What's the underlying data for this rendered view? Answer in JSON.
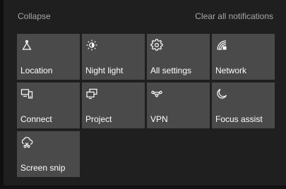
{
  "header": {
    "collapse_label": "Collapse",
    "clear_label": "Clear all notifications"
  },
  "tiles": [
    {
      "label": "Location",
      "icon": "location-icon"
    },
    {
      "label": "Night light",
      "icon": "night-light-icon"
    },
    {
      "label": "All settings",
      "icon": "gear-icon"
    },
    {
      "label": "Network",
      "icon": "network-icon"
    },
    {
      "label": "Connect",
      "icon": "connect-icon"
    },
    {
      "label": "Project",
      "icon": "project-icon"
    },
    {
      "label": "VPN",
      "icon": "vpn-icon"
    },
    {
      "label": "Focus assist",
      "icon": "moon-icon"
    },
    {
      "label": "Screen snip",
      "icon": "screen-snip-icon"
    }
  ],
  "colors": {
    "background": "#1f1f1f",
    "tile": "#4a4a4a",
    "header_text": "#a7a7a7",
    "tile_text": "#ffffff"
  }
}
